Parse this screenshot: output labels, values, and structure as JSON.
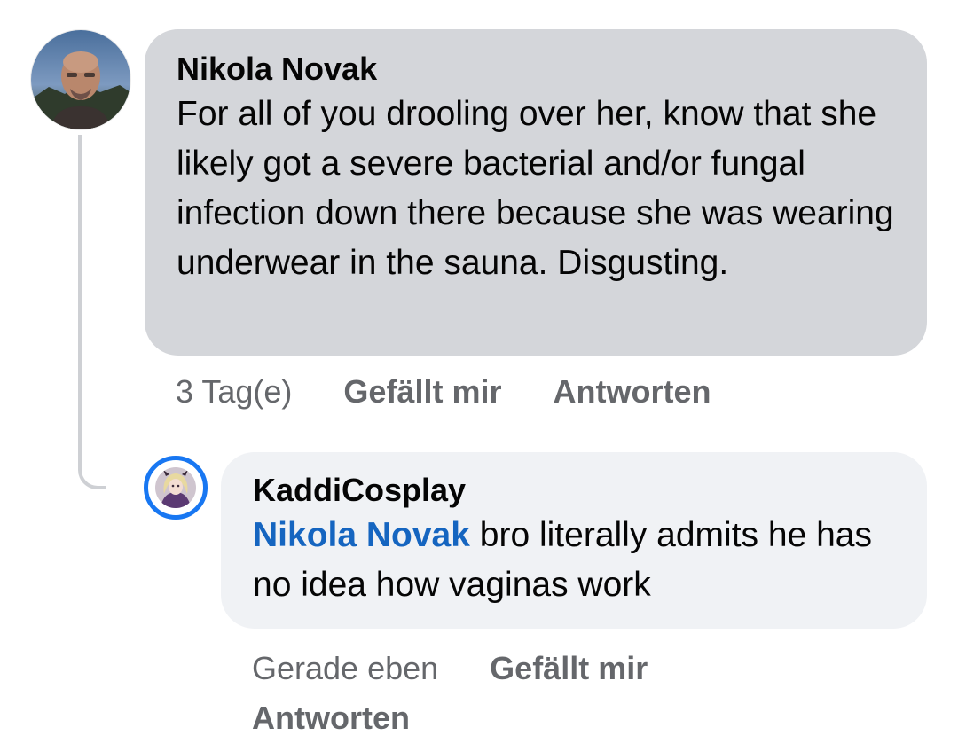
{
  "comment": {
    "author": "Nikola Novak",
    "text": "For all of you drooling over her, know that she likely got a severe bacterial and/or fungal infection down there because she was wearing underwear in the sauna. Disgusting.",
    "time": "3 Tag(e)",
    "like_label": "Gefällt mir",
    "reply_label": "Antworten",
    "avatar_icon": "user-photo-avatar"
  },
  "reply": {
    "author": "KaddiCosplay",
    "mention": "Nikola Novak",
    "text": " bro literally admits he has no idea how vaginas work",
    "time": "Gerade eben",
    "like_label": "Gefällt mir",
    "reply_label": "Antworten",
    "avatar_icon": "user-photo-avatar",
    "avatar_ring_color": "#1877f2"
  },
  "colors": {
    "main_bubble": "#d4d6da",
    "reply_bubble": "#f0f2f5",
    "meta_text": "#65676b",
    "mention": "#1565c0"
  }
}
